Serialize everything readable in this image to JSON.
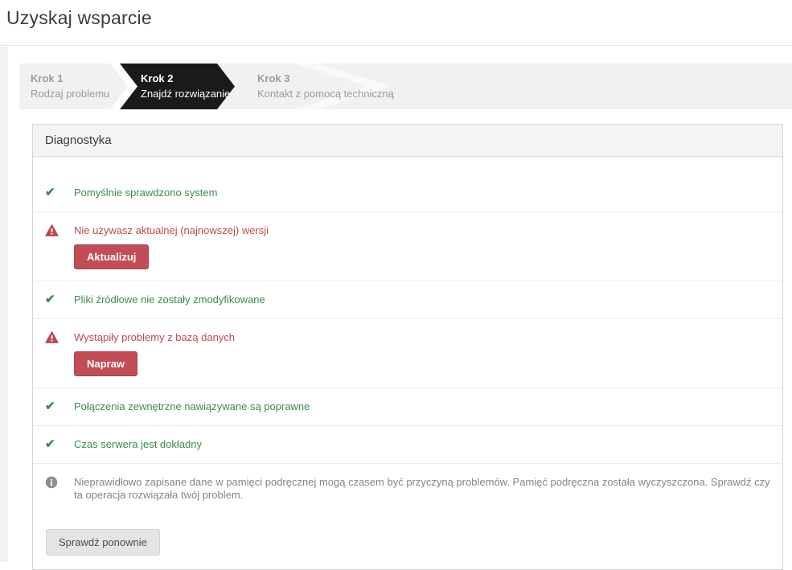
{
  "page": {
    "title": "Uzyskaj wsparcie"
  },
  "stepper": {
    "steps": [
      {
        "label": "Krok 1",
        "sublabel": "Rodzaj problemu",
        "state": "inactive"
      },
      {
        "label": "Krok 2",
        "sublabel": "Znajdź rozwiązanie",
        "state": "active"
      },
      {
        "label": "Krok 3",
        "sublabel": "Kontakt z pomocą techniczną",
        "state": "inactive"
      }
    ]
  },
  "panel": {
    "title": "Diagnostyka",
    "items": [
      {
        "type": "success",
        "icon": "check-icon",
        "text": "Pomyślnie sprawdzono system"
      },
      {
        "type": "error",
        "icon": "warning-icon",
        "text": "Nie używasz aktualnej (najnowszej) wersji",
        "action": "Aktualizuj"
      },
      {
        "type": "success",
        "icon": "check-icon",
        "text": "Pliki źródłowe nie zostały zmodyfikowane"
      },
      {
        "type": "error",
        "icon": "warning-icon",
        "text": "Wystąpiły problemy z bazą danych",
        "action": "Napraw"
      },
      {
        "type": "success",
        "icon": "check-icon",
        "text": "Połączenia zewnętrzne nawiązywane są poprawne"
      },
      {
        "type": "success",
        "icon": "check-icon",
        "text": "Czas serwera jest dokładny"
      },
      {
        "type": "info",
        "icon": "info-icon",
        "text": "Nieprawidłowo zapisane dane w pamięci podręcznej mogą czasem być przyczyną problemów. Pamięć podręczna została wyczyszczona. Sprawdź czy ta operacja rozwiązała twój problem."
      }
    ],
    "retry_button": "Sprawdź ponownie"
  },
  "colors": {
    "success": "#3e8a4e",
    "danger": "#c24d57",
    "danger_border": "#a94350",
    "info_gray": "#8d8d8d",
    "step_active_bg": "#1a1a1a",
    "stepper_bg": "#f1f1f2"
  }
}
